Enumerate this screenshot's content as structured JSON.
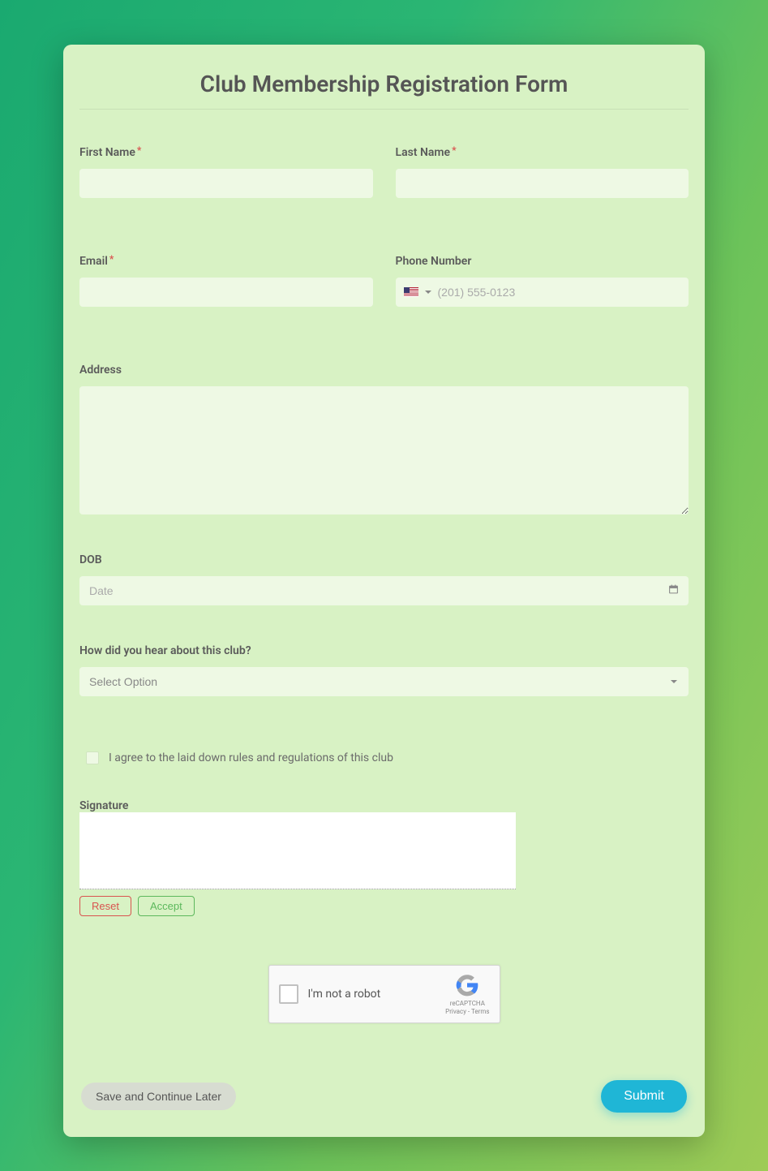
{
  "title": "Club Membership Registration Form",
  "fields": {
    "first_name": {
      "label": "First Name",
      "required": true
    },
    "last_name": {
      "label": "Last Name",
      "required": true
    },
    "email": {
      "label": "Email",
      "required": true
    },
    "phone": {
      "label": "Phone Number",
      "placeholder": "(201) 555-0123",
      "country": "US"
    },
    "address": {
      "label": "Address"
    },
    "dob": {
      "label": "DOB",
      "placeholder": "Date"
    },
    "hear_about": {
      "label": "How did you hear about this club?",
      "placeholder": "Select Option"
    },
    "agree": {
      "label": "I agree to the laid down rules and regulations of this club",
      "checked": false
    },
    "signature": {
      "label": "Signature"
    }
  },
  "buttons": {
    "reset": "Reset",
    "accept": "Accept",
    "save_later": "Save and Continue Later",
    "submit": "Submit"
  },
  "captcha": {
    "label": "I'm not a robot",
    "brand": "reCAPTCHA",
    "links": "Privacy - Terms"
  }
}
